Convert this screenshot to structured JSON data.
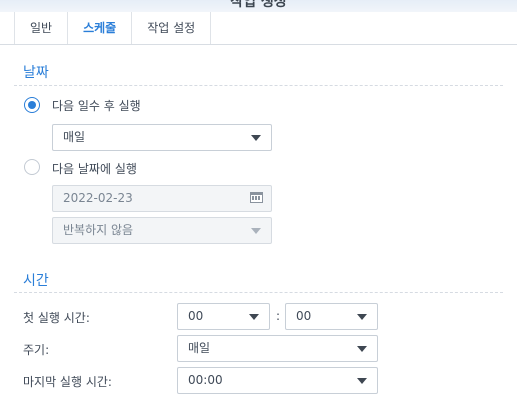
{
  "window": {
    "title": "작업 생성"
  },
  "tabs": [
    {
      "label": "일반"
    },
    {
      "label": "스케줄"
    },
    {
      "label": "작업 설정"
    }
  ],
  "date_section": {
    "title": "날짜",
    "option_days": {
      "label": "다음 일수 후 실행",
      "selected": true
    },
    "days_select": {
      "value": "매일"
    },
    "option_date": {
      "label": "다음 날짜에 실행",
      "selected": false
    },
    "date_field": {
      "value": "2022-02-23"
    },
    "repeat_select": {
      "value": "반복하지 않음"
    }
  },
  "time_section": {
    "title": "시간",
    "first_run": {
      "label": "첫 실행 시간:",
      "hour": "00",
      "minute": "00",
      "separator": ":"
    },
    "frequency": {
      "label": "주기:",
      "value": "매일"
    },
    "last_run": {
      "label": "마지막 실행 시간:",
      "value": "00:00"
    }
  },
  "colors": {
    "accent": "#2a7ed8",
    "text": "#404a58",
    "border": "#c8cfd7"
  }
}
